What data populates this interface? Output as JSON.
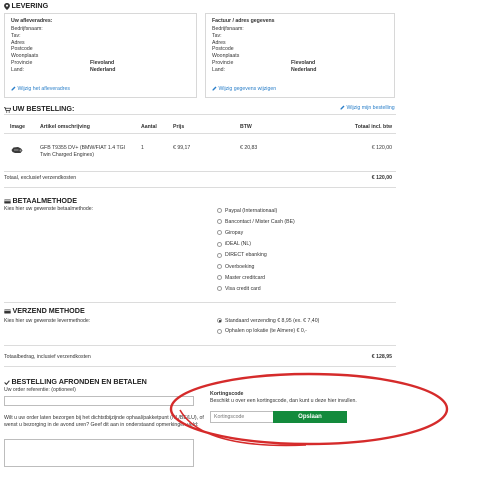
{
  "levering": {
    "title": "LEVERING",
    "ship_box": {
      "heading": "Uw afleveradres:",
      "rows": [
        {
          "label": "Bedrijfsnaam:",
          "value": ""
        },
        {
          "label": "Tav:",
          "value": ""
        },
        {
          "label": "Adres",
          "value": ""
        },
        {
          "label": "Postcode",
          "value": ""
        },
        {
          "label": "Woonplaats",
          "value": ""
        },
        {
          "label": "Provincie",
          "value": "Flevoland"
        },
        {
          "label": "Land:",
          "value": "Nederland"
        }
      ],
      "link": "Wijzig het afleveradres"
    },
    "bill_box": {
      "heading": "Factuur / adres gegevens",
      "rows": [
        {
          "label": "Bedrijfsnaam:",
          "value": ""
        },
        {
          "label": "Tav:",
          "value": ""
        },
        {
          "label": "Adres",
          "value": ""
        },
        {
          "label": "Postcode",
          "value": ""
        },
        {
          "label": "Woonplaats",
          "value": ""
        },
        {
          "label": "Provincie",
          "value": "Flevoland"
        },
        {
          "label": "Land:",
          "value": "Nederland"
        }
      ],
      "link": "Wijzig gegevens wijzigen"
    }
  },
  "bestelling": {
    "title": "UW BESTELLING:",
    "edit_link": "Wijzig mijn bestelling",
    "columns": {
      "image": "Image",
      "desc": "Artikel omschrijving",
      "qty": "Aantal",
      "price": "Prijs",
      "vat": "BTW",
      "total": "Totaal incl. btw"
    },
    "item": {
      "desc": "GFB T9355 DV+ (BMW/FIAT 1.4 TGI Twin Charged Engines)",
      "qty": "1",
      "price": "€ 99,17",
      "vat": "€ 20,83",
      "total": "€ 120,00"
    },
    "subtotal_label": "Totaal, exclusief verzendkosten",
    "subtotal_value": "€ 120,00"
  },
  "betaalmethode": {
    "title": "BETAALMETHODE",
    "prompt": "Kies hier uw gewenste betaalmethode:",
    "options": [
      "Paypal (Internationaal)",
      "Bancontact / Mister Cash (BE)",
      "Giropay",
      "iDEAL (NL)",
      "DIRECT ebanking",
      "Overboeking",
      "Master creditcard",
      "Visa credit card"
    ]
  },
  "verzend": {
    "title": "VERZEND METHODE",
    "prompt": "Kies hier uw gewenste levermethode:",
    "options": [
      "Standaard verzending € 8,95 (ex. € 7,40)",
      "Ophalen op lokatie (te Almere) € 0,-"
    ],
    "selected_index": 0
  },
  "totaal": {
    "label": "Totaalbedrag, inclusief verzendkosten",
    "value": "€ 128,95"
  },
  "afronden": {
    "title": "BESTELLING AFRONDEN EN BETALEN",
    "ref_label": "Uw order referentie: (optioneel)",
    "ref_value": "",
    "note_text": "Wilt u uw order laten bezorgen bij het dichtstbijzijnde ophaal/pakketpunt (NL/BE/LU), of wenst u bezorging in de avond uren? Geef dit aan in onderstaand opmerkingen veld:",
    "remarks_value": ""
  },
  "korting": {
    "title": "Kortingscode",
    "description": "Beschikt u over een kortingscode, dan kunt u deze hier invullen.",
    "placeholder": "Kortingscode",
    "button": "Opslaan"
  },
  "colors": {
    "accent_link": "#2a7fc9",
    "button_green": "#138a3c",
    "annotation_red": "#d52b2b"
  },
  "icons": [
    "map-marker-icon",
    "cart-icon",
    "pencil-icon",
    "credit-card-icon",
    "truck-icon",
    "checkmark-icon"
  ]
}
